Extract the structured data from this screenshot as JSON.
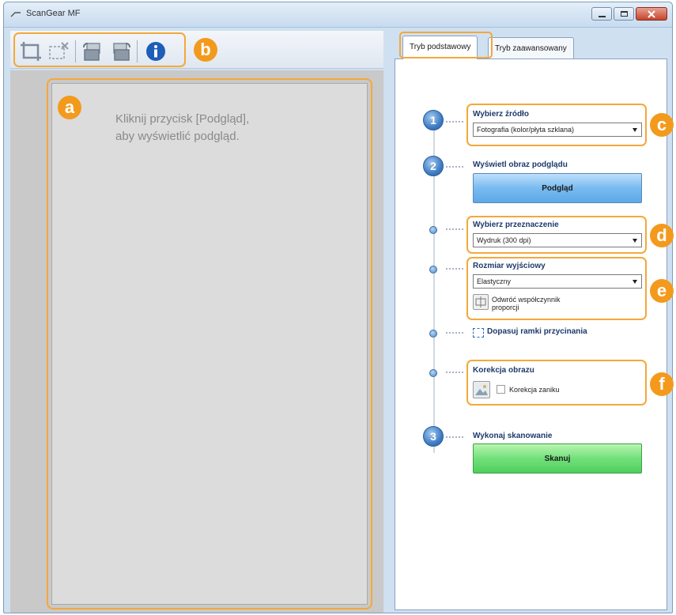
{
  "window": {
    "title": "ScanGear MF"
  },
  "toolbar": {
    "callout": "b",
    "icons": [
      "crop-icon",
      "remove-crop-icon",
      "rotate-left-icon",
      "rotate-right-icon",
      "info-icon"
    ]
  },
  "preview": {
    "callout": "a",
    "hint": "Kliknij przycisk [Podgląd],\naby wyświetlić podgląd."
  },
  "tabs": {
    "basic": "Tryb podstawowy",
    "advanced": "Tryb zaawansowany"
  },
  "steps": {
    "step1": {
      "number": "1",
      "label": "Wybierz źródło",
      "select_value": "Fotografia (kolor/płyta szklana)",
      "callout": "c"
    },
    "step2": {
      "number": "2",
      "label": "Wyświetl obraz podglądu",
      "button": "Podgląd"
    },
    "destination": {
      "label": "Wybierz przeznaczenie",
      "select_value": "Wydruk (300 dpi)",
      "callout": "d"
    },
    "output_size": {
      "label": "Rozmiar wyjściowy",
      "select_value": "Elastyczny",
      "invert_label": "Odwróć współczynnik proporcji",
      "callout": "e"
    },
    "crop": {
      "label": "Dopasuj ramki przycinania"
    },
    "correction": {
      "label": "Korekcja obrazu",
      "checkbox_label": "Korekcja zaniku",
      "checked": false,
      "callout": "f"
    },
    "step3": {
      "number": "3",
      "label": "Wykonaj skanowanie",
      "button": "Skanuj"
    }
  },
  "colors": {
    "highlight": "#f3a83a",
    "callout": "#f39a1d",
    "preview_button": "#78bbf0",
    "scan_button": "#72e07a"
  }
}
